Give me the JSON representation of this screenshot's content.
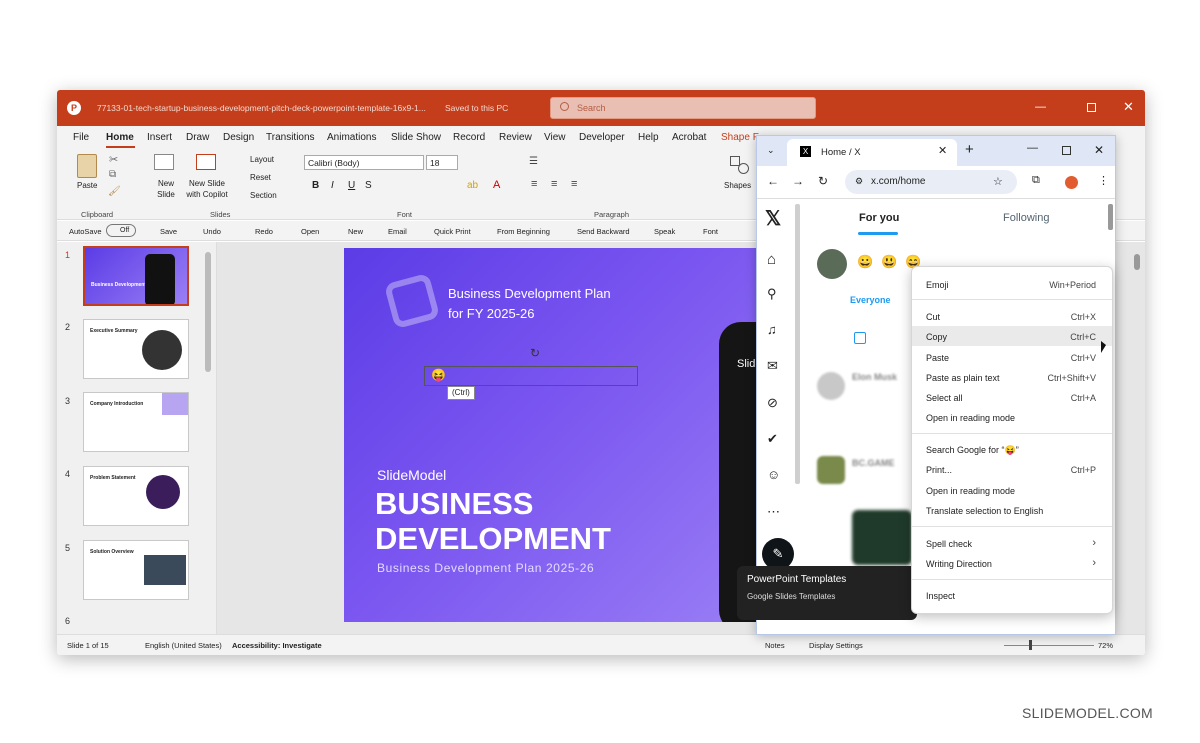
{
  "ppt": {
    "title": "77133-01-tech-startup-business-development-pitch-deck-powerpoint-template-16x9-1...",
    "saved": "Saved to this PC",
    "search_placeholder": "Search",
    "tabs": [
      "File",
      "Home",
      "Insert",
      "Draw",
      "Design",
      "Transitions",
      "Animations",
      "Slide Show",
      "Record",
      "Review",
      "View",
      "Developer",
      "Help",
      "Acrobat",
      "Shape F"
    ],
    "ribbon": {
      "paste": "Paste",
      "clipboard": "Clipboard",
      "new_slide": "New Slide",
      "new_slide_copilot": "New Slide with Copilot",
      "layout": "Layout",
      "reset": "Reset",
      "section": "Section",
      "slides": "Slides",
      "font_name": "Calibri (Body)",
      "font_size": "18",
      "font": "Font",
      "paragraph": "Paragraph",
      "shapes": "Shapes"
    },
    "qat": [
      "AutoSave",
      "Off",
      "Save",
      "Undo",
      "Redo",
      "Open",
      "New",
      "Email",
      "Quick Print",
      "From Beginning",
      "Send Backward",
      "Speak",
      "Font"
    ],
    "thumbnails": [
      {
        "num": "1",
        "title": "Business Development"
      },
      {
        "num": "2",
        "title": "Executive Summary"
      },
      {
        "num": "3",
        "title": "Company Introduction"
      },
      {
        "num": "4",
        "title": "Problem Statement"
      },
      {
        "num": "5",
        "title": "Solution Overview"
      },
      {
        "num": "6",
        "title": ""
      }
    ],
    "slide": {
      "header": "Business Development Plan for FY 2025-26",
      "brand": "SlideModel",
      "title1": "BUSINESS",
      "title2": "DEVELOPMENT",
      "subtitle": "Business Development Plan 2025-26",
      "paste_badge": "(Ctrl)",
      "phone_text1": "PowerPoint Templates",
      "phone_text2": "Google Slides Templates",
      "phone_tag": "Slid"
    },
    "status": {
      "slide": "Slide 1 of 15",
      "lang": "English (United States)",
      "access": "Accessibility: Investigate",
      "notes": "Notes",
      "display": "Display Settings",
      "zoom": "72%"
    }
  },
  "browser": {
    "tab_title": "Home / X",
    "url": "x.com/home",
    "for_you": "For you",
    "following": "Following",
    "everyone": "Everyone",
    "emojis": [
      "😀",
      "😃",
      "😄"
    ],
    "post1": "Elon Musk",
    "post2": "BC.GAME"
  },
  "context_menu": [
    {
      "label": "Emoji",
      "key": "Win+Period"
    },
    {
      "label": "Cut",
      "key": "Ctrl+X"
    },
    {
      "label": "Copy",
      "key": "Ctrl+C"
    },
    {
      "label": "Paste",
      "key": "Ctrl+V"
    },
    {
      "label": "Paste as plain text",
      "key": "Ctrl+Shift+V"
    },
    {
      "label": "Select all",
      "key": "Ctrl+A"
    },
    {
      "label": "Open in reading mode",
      "key": ""
    },
    {
      "label": "Search Google for “😝”",
      "key": ""
    },
    {
      "label": "Print...",
      "key": "Ctrl+P"
    },
    {
      "label": "Open in reading mode",
      "key": ""
    },
    {
      "label": "Translate selection to English",
      "key": ""
    },
    {
      "label": "Spell check",
      "key": "›"
    },
    {
      "label": "Writing Direction",
      "key": "›"
    },
    {
      "label": "Inspect",
      "key": ""
    }
  ],
  "watermark": "SLIDEMODEL.COM",
  "colors": {
    "ppt_accent": "#c43e1c",
    "slide_bg": "#6a47ee",
    "x_blue": "#1d9bf0"
  }
}
